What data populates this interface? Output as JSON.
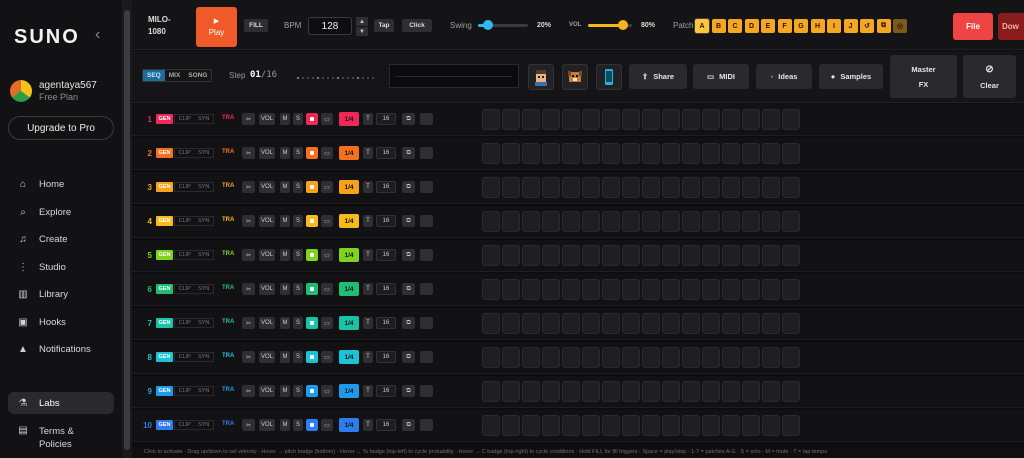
{
  "sidebar": {
    "logo": "SUNO",
    "username": "agentaya567",
    "plan": "Free Plan",
    "upgrade_label": "Upgrade to Pro",
    "nav": [
      {
        "label": "Home",
        "icon": "home-icon",
        "glyph": "⌂"
      },
      {
        "label": "Explore",
        "icon": "search-icon",
        "glyph": "⌕"
      },
      {
        "label": "Create",
        "icon": "music-note-icon",
        "glyph": "♫"
      },
      {
        "label": "Studio",
        "icon": "sliders-icon",
        "glyph": "⋮"
      },
      {
        "label": "Library",
        "icon": "library-icon",
        "glyph": "▥"
      },
      {
        "label": "Hooks",
        "icon": "hook-icon",
        "glyph": "▣"
      },
      {
        "label": "Notifications",
        "icon": "bell-icon",
        "glyph": "▲"
      },
      {
        "label": "Labs",
        "icon": "flask-icon",
        "glyph": "⚗"
      },
      {
        "label": "Terms & Policies",
        "icon": "document-icon",
        "glyph": "▤"
      }
    ]
  },
  "topbar": {
    "project_name_1": "MILO-",
    "project_name_2": "1080",
    "play_label": "Play",
    "fill_label": "FILL",
    "bpm_label": "BPM",
    "bpm_value": "128",
    "tap_label": "Tap",
    "click_label": "Click",
    "swing_label": "Swing",
    "swing_value": "20%",
    "swing_level": 0.2,
    "vol_label": "VOL",
    "vol_value": "80%",
    "vol_level": 0.8,
    "patch_label": "Patch",
    "patches": [
      "A",
      "B",
      "C",
      "D",
      "E",
      "F",
      "G",
      "H",
      "I",
      "J",
      "↺",
      "⧉",
      "◎"
    ],
    "file_label": "File",
    "download_label": "Dow"
  },
  "toolbar": {
    "modes": [
      "SEQ",
      "MIX",
      "SONG"
    ],
    "step_label": "Step",
    "step_current": "01",
    "step_total": "/16",
    "share_label": "Share",
    "midi_label": "MIDI",
    "ideas_label": "Ideas",
    "samples_label": "Samples",
    "master_fx_1": "Master",
    "master_fx_2": "FX",
    "clear_label": "Clear"
  },
  "track_controls": {
    "gen": "GEN",
    "clip": "CLIP",
    "syn": "SYN",
    "tra": "TRA",
    "vol": "VOL",
    "mute": "M",
    "solo": "S",
    "quarter": "1/4",
    "t": "T",
    "steps": "16"
  },
  "tracks": [
    {
      "num": "1",
      "color": "#f0285a"
    },
    {
      "num": "2",
      "color": "#f4701e"
    },
    {
      "num": "3",
      "color": "#f6a31b"
    },
    {
      "num": "4",
      "color": "#f6bb1a"
    },
    {
      "num": "5",
      "color": "#7ed321"
    },
    {
      "num": "6",
      "color": "#1fbf73"
    },
    {
      "num": "7",
      "color": "#19c3a6"
    },
    {
      "num": "8",
      "color": "#1ec2d6"
    },
    {
      "num": "9",
      "color": "#1e9be8"
    },
    {
      "num": "10",
      "color": "#2f7bf0"
    }
  ],
  "hint_text": "Click to activate · Drag up/down to set velocity · Hover → pitch badge (bottom) · Hover → % badge (top-left) to cycle probability · Hover → C badge (top-right) to cycle conditions · Hold FILL for fill triggers · Space = play/stop · 1-7 = patches A-G · S = solo · M = mute · T = tap tempo"
}
